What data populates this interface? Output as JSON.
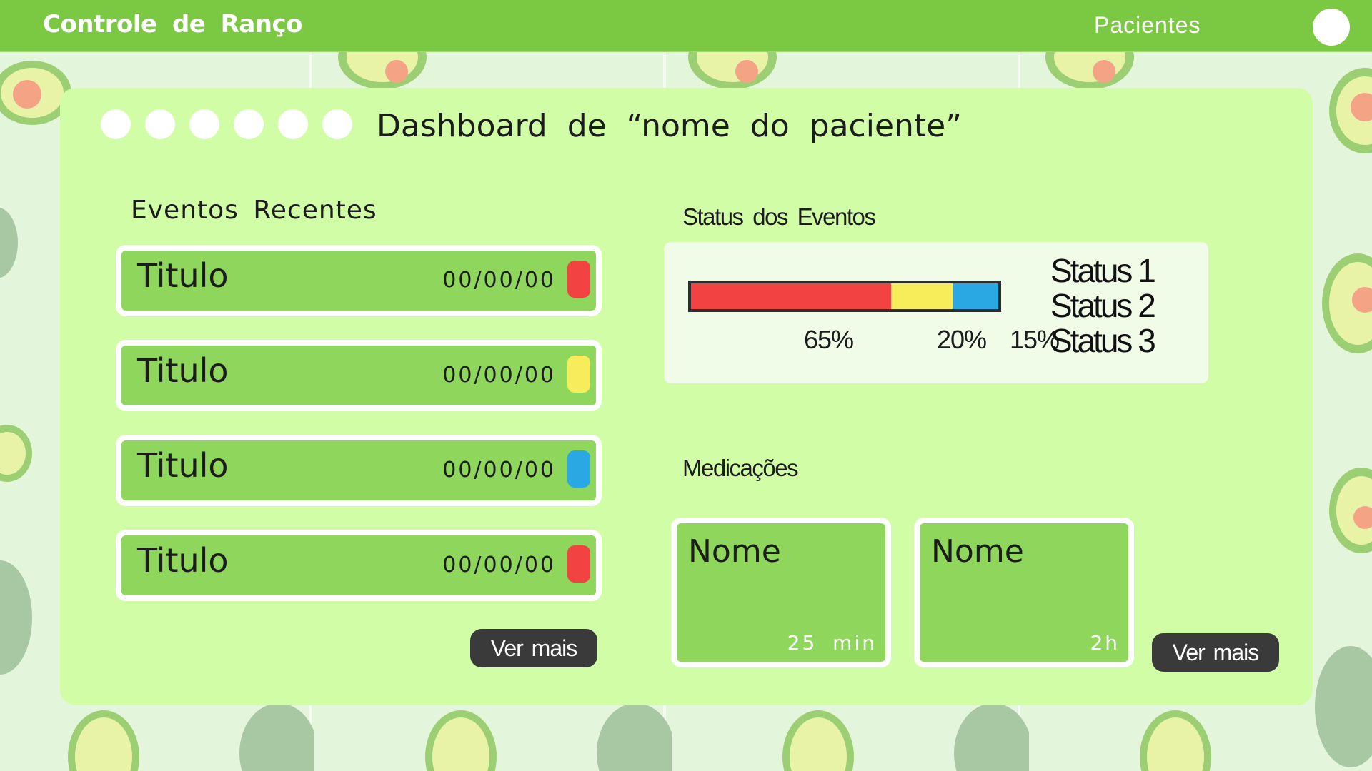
{
  "header": {
    "brand": "Controle de Ranço",
    "nav_patients": "Pacientes"
  },
  "dashboard": {
    "title": "Dashboard de “nome do paciente”"
  },
  "recent_events": {
    "title": "Eventos Recentes",
    "items": [
      {
        "title": "Titulo",
        "date": "00/00/00",
        "color": "#f24242"
      },
      {
        "title": "Titulo",
        "date": "00/00/00",
        "color": "#f7ec5a"
      },
      {
        "title": "Titulo",
        "date": "00/00/00",
        "color": "#2aa8e4"
      },
      {
        "title": "Titulo",
        "date": "00/00/00",
        "color": "#f24242"
      }
    ],
    "more_label": "Ver mais"
  },
  "event_status": {
    "title": "Status dos Eventos",
    "segments": [
      {
        "pct": 65,
        "label": "65%",
        "color": "#f24242"
      },
      {
        "pct": 20,
        "label": "20%",
        "color": "#f7ec5a"
      },
      {
        "pct": 15,
        "label": "15%",
        "color": "#2aa8e4"
      }
    ],
    "legend": [
      "Status 1",
      "Status 2",
      "Status 3"
    ]
  },
  "medications": {
    "title": "Medicações",
    "items": [
      {
        "name": "Nome",
        "time": "25 min"
      },
      {
        "name": "Nome",
        "time": "2h"
      }
    ],
    "more_label": "Ver mais"
  },
  "colors": {
    "topbar": "#7bc943",
    "card": "#d1fda7",
    "row": "#8fd65c",
    "button": "#3a3a3a"
  }
}
